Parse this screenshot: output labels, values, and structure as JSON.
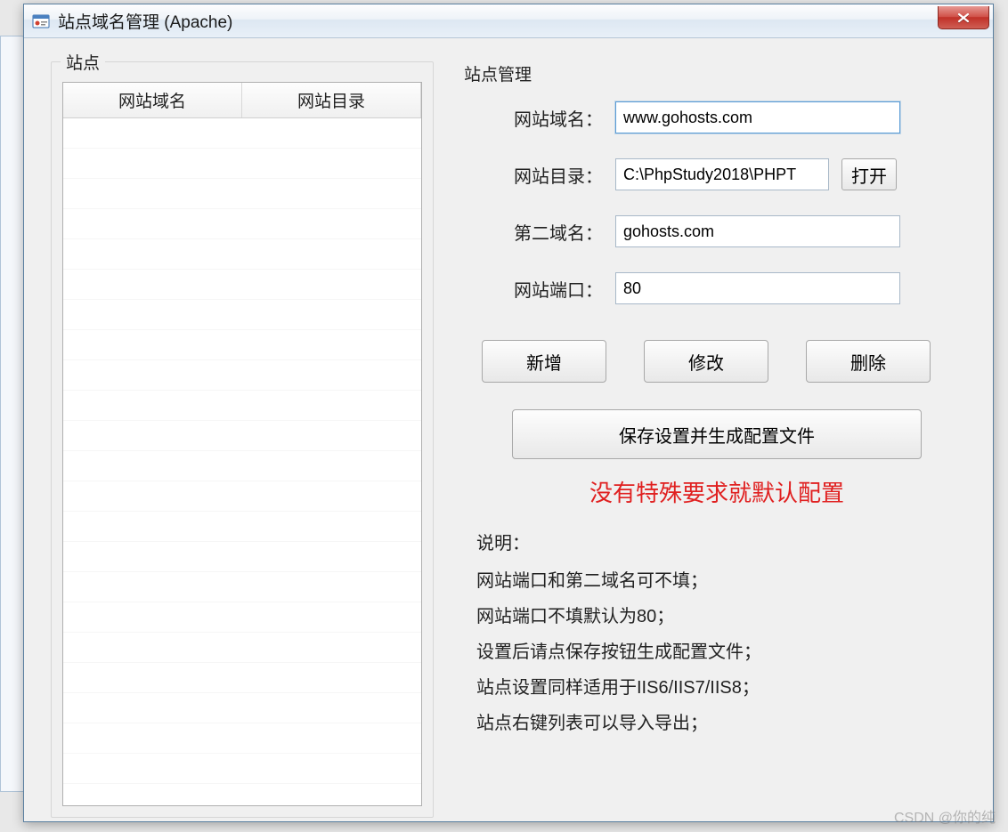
{
  "window": {
    "title": "站点域名管理 (Apache)"
  },
  "left_group": {
    "title": "站点",
    "columns": [
      "网站域名",
      "网站目录"
    ]
  },
  "right_group": {
    "title": "站点管理"
  },
  "form": {
    "domain_label": "网站域名：",
    "domain_value": "www.gohosts.com",
    "dir_label": "网站目录：",
    "dir_value": "C:\\PhpStudy2018\\PHPT",
    "open_label": "打开",
    "second_domain_label": "第二域名：",
    "second_domain_value": "gohosts.com",
    "port_label": "网站端口：",
    "port_value": "80"
  },
  "actions": {
    "add": "新增",
    "modify": "修改",
    "delete": "删除",
    "save": "保存设置并生成配置文件"
  },
  "red_note": "没有特殊要求就默认配置",
  "help": {
    "title": "说明：",
    "lines": [
      "网站端口和第二域名可不填；",
      "网站端口不填默认为80；",
      "设置后请点保存按钮生成配置文件；",
      "站点设置同样适用于IIS6/IIS7/IIS8；",
      "站点右键列表可以导入导出；"
    ]
  },
  "watermark": "CSDN @你的纯"
}
